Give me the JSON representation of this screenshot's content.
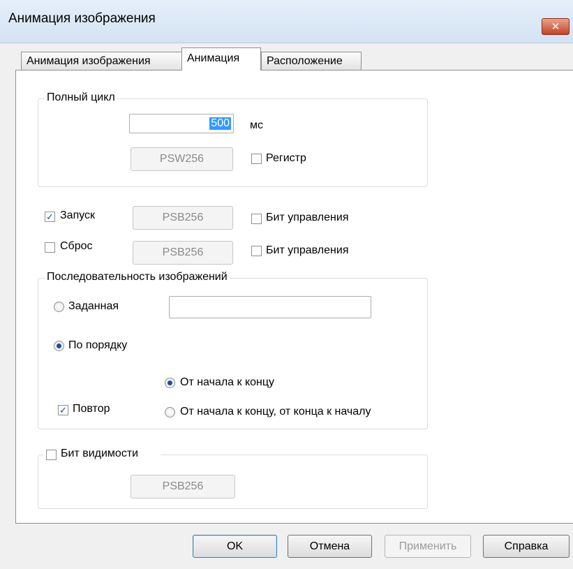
{
  "window": {
    "title": "Анимация изображения",
    "close_label": "✕"
  },
  "tabs": [
    "Анимация изображения",
    "Анимация",
    "Расположение"
  ],
  "full_cycle": {
    "legend": "Полный цикл",
    "value": "500",
    "unit": "мс",
    "register_address": "PSW256",
    "register_label": "Регистр",
    "register_checked": false
  },
  "start": {
    "label": "Запуск",
    "checked": true,
    "address": "PSB256",
    "control_bit_label": "Бит управления",
    "control_bit_checked": false
  },
  "reset": {
    "label": "Сброс",
    "checked": false,
    "address": "PSB256",
    "control_bit_label": "Бит управления",
    "control_bit_checked": false
  },
  "sequence": {
    "legend": "Последовательность изображений",
    "preset_label": "Заданная",
    "preset_value": "",
    "in_order_label": "По порядку",
    "selected": "in_order",
    "repeat_label": "Повтор",
    "repeat_checked": true,
    "direction_forward_label": "От начала к концу",
    "direction_pingpong_label": "От начала к концу, от конца к началу",
    "direction_selected": "forward"
  },
  "visibility": {
    "label": "Бит видимости",
    "checked": false,
    "address": "PSB256"
  },
  "buttons": {
    "ok": "OK",
    "cancel": "Отмена",
    "apply": "Применить",
    "help": "Справка"
  }
}
